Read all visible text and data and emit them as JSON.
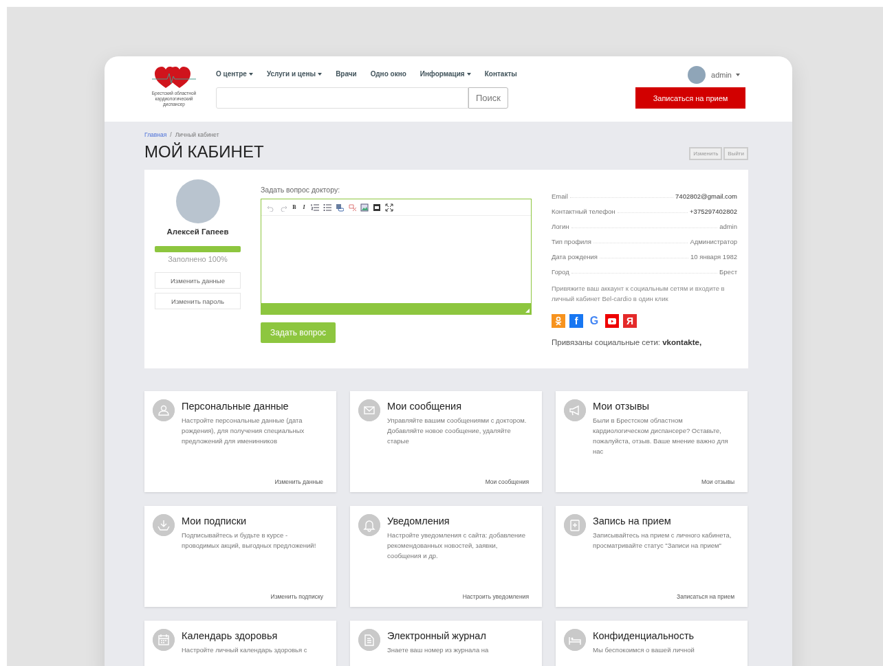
{
  "header": {
    "logo_caption": "Брестский областной кардиологический диспансер",
    "nav": [
      {
        "label": "О центре",
        "dropdown": true
      },
      {
        "label": "Услуги и цены",
        "dropdown": true
      },
      {
        "label": "Врачи",
        "dropdown": false
      },
      {
        "label": "Одно окно",
        "dropdown": false
      },
      {
        "label": "Информация",
        "dropdown": true
      },
      {
        "label": "Контакты",
        "dropdown": false
      }
    ],
    "search_button": "Поиск",
    "user": "admin",
    "appointment_button": "Записаться на прием"
  },
  "breadcrumb_separator": "/",
  "breadcrumb": [
    {
      "label": "Главная",
      "current": false
    },
    {
      "label": "Личный кабинет",
      "current": true
    }
  ],
  "title": "МОЙ КАБИНЕТ",
  "title_actions": [
    "Изменить",
    "Выйти"
  ],
  "profile": {
    "name": "Алексей Гапеев",
    "level": 1,
    "progress_label": "Заполнено 100%",
    "buttons": [
      "Изменить данные",
      "Изменить пароль"
    ]
  },
  "question": {
    "label": "Задать вопрос доктору:",
    "toolbar": [
      {
        "kind": "undo",
        "disabled": true
      },
      {
        "kind": "redo",
        "disabled": true
      },
      {
        "kind": "bold",
        "label": "B",
        "disabled": false
      },
      {
        "kind": "italic",
        "label": "I",
        "disabled": false
      },
      {
        "kind": "numbered-list",
        "disabled": false
      },
      {
        "kind": "bullet-list",
        "disabled": false
      },
      {
        "kind": "link",
        "disabled": false
      },
      {
        "kind": "unlink",
        "disabled": false
      },
      {
        "kind": "image",
        "disabled": false
      },
      {
        "kind": "video",
        "disabled": false
      },
      {
        "kind": "fullscreen",
        "disabled": false
      }
    ],
    "submit": "Задать вопрос"
  },
  "info": [
    {
      "label": "Email",
      "value": "7402802@gmail.com",
      "strong": true
    },
    {
      "label": "Контактный телефон",
      "value": "+375297402802",
      "strong": true
    },
    {
      "label": "Логин",
      "value": "admin",
      "strong": false
    },
    {
      "label": "Тип профиля",
      "value": "Администратор",
      "strong": false
    },
    {
      "label": "Дата рождения",
      "value": "10 января 1982",
      "strong": false
    },
    {
      "label": "Город",
      "value": "Брест",
      "strong": false
    }
  ],
  "social_hint": "Привяжите ваш аккаунт к социальным сетям и входите в личный кабинет Bel-cardio в один клик",
  "social": [
    {
      "kind": "ok"
    },
    {
      "kind": "facebook",
      "glyph": "f"
    },
    {
      "kind": "google",
      "glyph": "G"
    },
    {
      "kind": "youtube"
    },
    {
      "kind": "yandex",
      "glyph": "Я"
    }
  ],
  "linked": "Привязаны социальные сети: **vkontakte,**",
  "cards": [
    {
      "title": "Персональные данные",
      "text": "Настройте персональные данные (дата рождения), для получения специальных предложений для именинников",
      "link": "Изменить данные"
    },
    {
      "title": "Мои сообщения",
      "text": "Управляйте вашим сообщениями с доктором. Добавляйте новое сообщение, удаляйте старые",
      "link": "Мои сообщения"
    },
    {
      "title": "Мои отзывы",
      "text": "Были в Брестском областном кардиологическом диспансере? Оставьте, пожалуйста, отзыв. Ваше мнение важно для нас",
      "link": "Мои отзывы"
    },
    {
      "title": "Мои подписки",
      "text": "Подписывайтесь и будьте в курсе - проводимых акций, выгодных предложений!",
      "link": "Изменить подписку"
    },
    {
      "title": "Уведомления",
      "text": "Настройте уведомления с сайта: добавление рекомендованных новостей, заявки, сообщения и др.",
      "link": "Настроить уведомления"
    },
    {
      "title": "Запись на прием",
      "text": "Записывайтесь на прием с личного кабинета, просматривайте статус \"Записи на прием\"",
      "link": "Записаться на прием"
    },
    {
      "title": "Календарь здоровья",
      "text": "Настройте личный календарь здоровья с"
    },
    {
      "title": "Электронный журнал",
      "text": "Знаете ваш номер из журнала на"
    },
    {
      "title": "Конфиденциальность",
      "text": "Мы беспокоимся о вашей личной"
    }
  ]
}
